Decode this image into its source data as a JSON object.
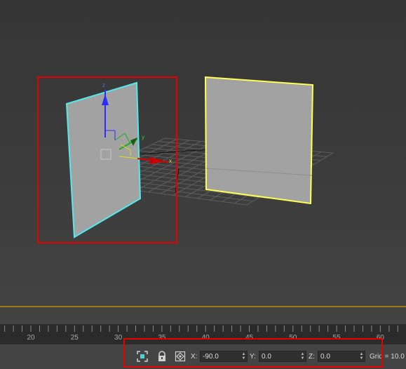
{
  "viewport": {
    "gizmo_labels": {
      "x": "x",
      "y": "y",
      "z": "z"
    }
  },
  "timeline": {
    "ticks": [
      "20",
      "25",
      "30",
      "35",
      "40",
      "45",
      "50",
      "55",
      "60"
    ]
  },
  "status_bar": {
    "icons": [
      "selection-mode-icon",
      "lock-icon",
      "transform-type-in-icon"
    ],
    "x_label": "X:",
    "x_value": "-90.0",
    "y_label": "Y:",
    "y_value": "0.0",
    "z_label": "Z:",
    "z_value": "0.0",
    "grid_text": "Grid = 10.0"
  },
  "colors": {
    "highlight": "#e60000",
    "selected_plane_outline": "#55e8ea",
    "other_plane_outline": "#ffff55",
    "plane_fill": "#a2a2a2",
    "timeline_line": "#9b7a1a"
  }
}
